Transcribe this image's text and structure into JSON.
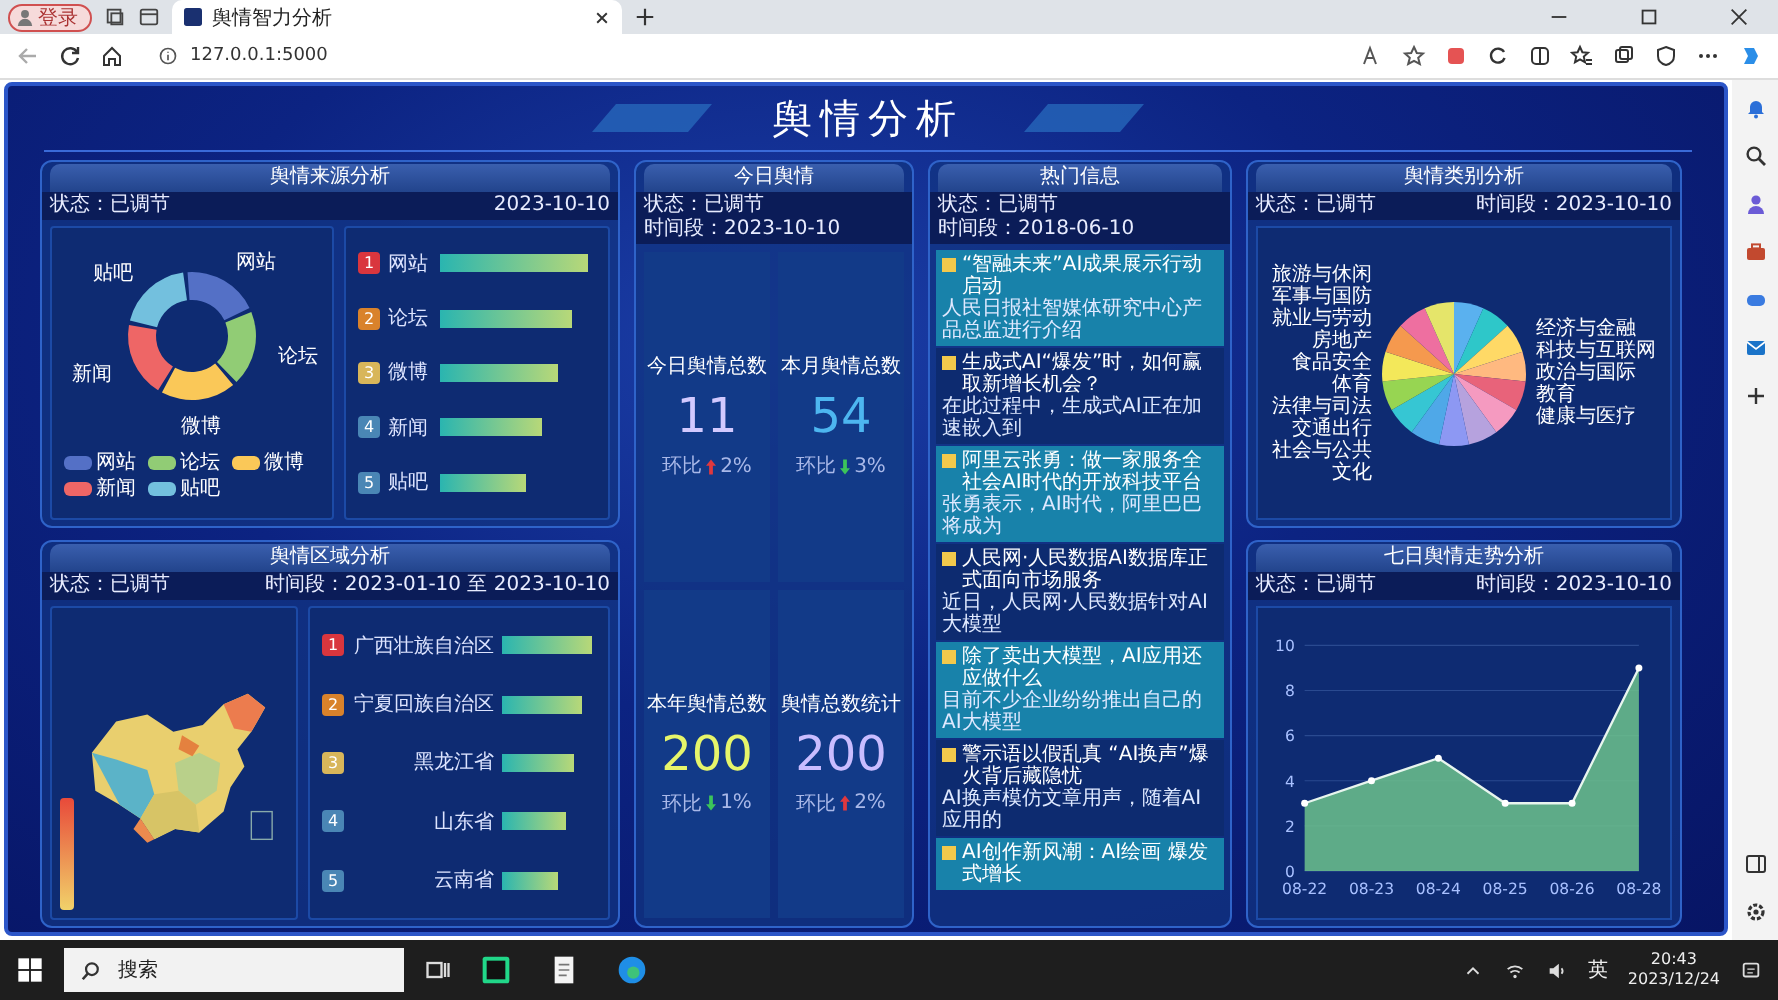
{
  "browser": {
    "profile_button": "登录",
    "tab_title": "舆情智力分析",
    "address": "127.0.0.1:5000"
  },
  "title": "舆情分析",
  "source_panel": {
    "title": "舆情来源分析",
    "status": "状态：已调节",
    "time": "2023-10-10",
    "donut_labels": [
      {
        "label": "网站",
        "color": "#5470c6"
      },
      {
        "label": "论坛",
        "color": "#91cc75"
      },
      {
        "label": "微博",
        "color": "#fac858"
      },
      {
        "label": "新闻",
        "color": "#ee6666"
      },
      {
        "label": "贴吧",
        "color": "#73c0de"
      }
    ],
    "legend": [
      {
        "label": "网站",
        "color": "#5470c6"
      },
      {
        "label": "论坛",
        "color": "#91cc75"
      },
      {
        "label": "微博",
        "color": "#fac858"
      },
      {
        "label": "新闻",
        "color": "#ee6666"
      },
      {
        "label": "贴吧",
        "color": "#73c0de"
      }
    ],
    "ranking": [
      {
        "rank": "1",
        "label": "网站",
        "color": "#d9363e"
      },
      {
        "rank": "2",
        "label": "论坛",
        "color": "#d9822b"
      },
      {
        "rank": "3",
        "label": "微博",
        "color": "#d8b65a"
      },
      {
        "rank": "4",
        "label": "新闻",
        "color": "#4a86b5"
      },
      {
        "rank": "5",
        "label": "贴吧",
        "color": "#4a86b5"
      }
    ]
  },
  "region_panel": {
    "title": "舆情区域分析",
    "status": "状态：已调节",
    "time": "时间段：2023-01-10 至 2023-10-10",
    "ranking": [
      {
        "rank": "1",
        "label": "广西壮族自治区",
        "color": "#d9363e"
      },
      {
        "rank": "2",
        "label": "宁夏回族自治区",
        "color": "#d9822b"
      },
      {
        "rank": "3",
        "label": "黑龙江省",
        "color": "#d8b65a"
      },
      {
        "rank": "4",
        "label": "山东省",
        "color": "#4a86b5"
      },
      {
        "rank": "5",
        "label": "云南省",
        "color": "#4a86b5"
      }
    ]
  },
  "today_panel": {
    "title": "今日舆情",
    "status": "状态：已调节",
    "time": "时间段：2023-10-10",
    "stats": [
      {
        "label": "今日舆情总数",
        "value": "11",
        "color": "#d2c9ff",
        "compare": "环比",
        "change": "2%",
        "increase": true
      },
      {
        "label": "本月舆情总数",
        "value": "54",
        "color": "#4db6f0",
        "compare": "环比",
        "change": "3%",
        "increase": false
      },
      {
        "label": "本年舆情总数",
        "value": "200",
        "color": "#e6f56a",
        "compare": "环比",
        "change": "1%",
        "increase": false
      },
      {
        "label": "舆情总数统计",
        "value": "200",
        "color": "#c9bcff",
        "compare": "环比",
        "change": "2%",
        "increase": true
      }
    ]
  },
  "hot_panel": {
    "title": "热门信息",
    "status": "状态：已调节",
    "time": "时间段：2018-06-10",
    "items": [
      {
        "title": "“智融未来”AI成果展示行动启动",
        "snippet": "人民日报社智媒体研究中心产品总监进行介绍"
      },
      {
        "title": "生成式AI“爆发”时，如何赢取新增长机会？",
        "snippet": "在此过程中，生成式AI正在加速嵌入到"
      },
      {
        "title": "阿里云张勇：做一家服务全社会AI时代的开放科技平台",
        "snippet": "张勇表示，AI时代，阿里巴巴将成为"
      },
      {
        "title": "人民网·人民数据AI数据库正式面向市场服务",
        "snippet": "近日，人民网·人民数据针对AI大模型"
      },
      {
        "title": "除了卖出大模型，AI应用还应做什么",
        "snippet": "目前不少企业纷纷推出自己的AI大模型"
      },
      {
        "title": "警示语以假乱真 “AI换声”爆火背后藏隐忧",
        "snippet": "AI换声模仿文章用声，随着AI应用的"
      },
      {
        "title": "AI创作新风潮：AI绘画 爆发式增长"
      }
    ]
  },
  "category_panel": {
    "title": "舆情类别分析",
    "status": "状态：已调节",
    "time": "时间段：2023-10-10",
    "labels": [
      {
        "label": "经济与金融",
        "color": "#5ab1ef"
      },
      {
        "label": "科技与互联网",
        "color": "#2ec7c9"
      },
      {
        "label": "政治与国际",
        "color": "#ffd966"
      },
      {
        "label": "教育",
        "color": "#ffb980"
      },
      {
        "label": "健康与医疗",
        "color": "#e8637a"
      },
      {
        "label": "旅游与休闲",
        "color": "#f59ac0"
      },
      {
        "label": "军事与国防",
        "color": "#b6a2de"
      },
      {
        "label": "就业与劳动",
        "color": "#8d98f3"
      },
      {
        "label": "房地产",
        "color": "#4fa8e8"
      },
      {
        "label": "食品安全",
        "color": "#36c6d3"
      },
      {
        "label": "体育",
        "color": "#97d552"
      },
      {
        "label": "法律与司法",
        "color": "#f3e85a"
      },
      {
        "label": "交通出行",
        "color": "#f5994e"
      },
      {
        "label": "社会与公共",
        "color": "#ee6fa0"
      },
      {
        "label": "文化",
        "color": "#e5e56a"
      }
    ]
  },
  "trend_panel": {
    "title": "七日舆情走势分析",
    "status": "状态：已调节",
    "time": "时间段：2023-10-10",
    "chart_data": {
      "type": "area",
      "categories": [
        "08-22",
        "08-23",
        "08-24",
        "08-25",
        "08-26",
        "08-28"
      ],
      "series": [
        {
          "color": "#6cc28c",
          "values": [
            3,
            4,
            5,
            3,
            3,
            9
          ]
        }
      ],
      "ylim": [
        0,
        10
      ],
      "yticks": [
        0,
        2,
        4,
        6,
        8,
        10
      ],
      "grid": true
    }
  },
  "taskbar": {
    "search": "搜索",
    "input_method": "英",
    "time": "20:43",
    "date": "2023/12/24"
  }
}
